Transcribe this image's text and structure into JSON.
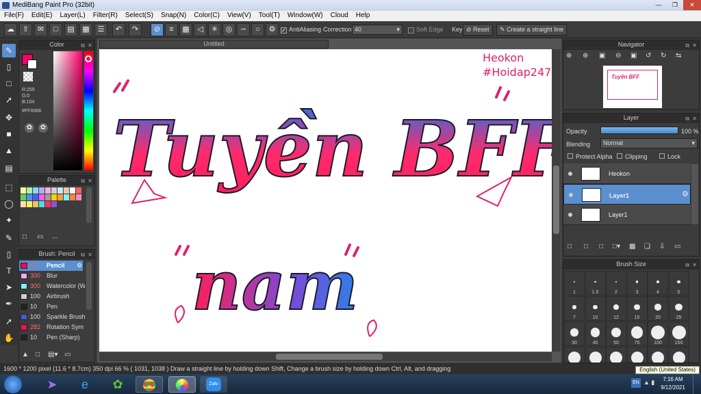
{
  "window": {
    "title": "MediBang Paint Pro (32bit)"
  },
  "menu": [
    "File(F)",
    "Edit(E)",
    "Layer(L)",
    "Filter(R)",
    "Select(S)",
    "Snap(N)",
    "Color(C)",
    "View(V)",
    "Tool(T)",
    "Window(W)",
    "Cloud",
    "Help"
  ],
  "toolbar": {
    "antialias": "AntiAliasing",
    "correction_label": "Correction",
    "correction_value": "40",
    "soft_edge": "Soft Edge",
    "key_label": "Key",
    "reset": "Reset",
    "straight_line": "Create a straight line"
  },
  "color_panel": {
    "title": "Color",
    "r": "R:255",
    "g": "G:0",
    "b": "B:104",
    "hex": "#FF0068",
    "fg": "#ff0068"
  },
  "palette_panel": {
    "title": "Palette",
    "swatches": [
      "#f6f6a0",
      "#a8f0a8",
      "#8bd6f2",
      "#b0b0f0",
      "#f0b0e0",
      "#d0d0d0",
      "#c8e8f8",
      "#e8c8a8",
      "#f8f8f8",
      "#ff6060",
      "#60d060",
      "#5090f0",
      "#4060ff",
      "#f060f0",
      "#a0a0a0",
      "#ffd000",
      "#f0a040",
      "#80f0f0",
      "#ff8040",
      "#f090c0",
      "#ffe0b0",
      "#f0f060",
      "#f0c060",
      "#40e0e0",
      "#ff3060",
      "#9050e0"
    ],
    "dash": "---"
  },
  "brush_panel": {
    "title": "Brush: Pencil",
    "items": [
      {
        "size": "4",
        "name": "Pencil",
        "color": "#ff0068"
      },
      {
        "size": "300",
        "name": "Blur",
        "color": "#f7a8f0"
      },
      {
        "size": "300",
        "name": "Watercolor (W",
        "color": "#8de8f8"
      },
      {
        "size": "100",
        "name": "Airbrush",
        "color": "#cfcfcf"
      },
      {
        "size": "10",
        "name": "Pen",
        "color": "#222222"
      },
      {
        "size": "100",
        "name": "Sparkle Brush",
        "color": "#3c5fd0"
      },
      {
        "size": "282",
        "name": "Rotation Sym",
        "color": "#ff1040"
      },
      {
        "size": "10",
        "name": "Pen (Sharp)",
        "color": "#222222"
      }
    ]
  },
  "document": {
    "tab": "Untitled"
  },
  "canvas_text": {
    "line1": "Heokon",
    "line2": "#Hoidap247",
    "title1": "Tuyền BFF",
    "title2": "nam"
  },
  "navigator": {
    "title": "Navigator"
  },
  "layer_panel": {
    "title": "Layer",
    "opacity_label": "Opacity",
    "opacity_value": "100 %",
    "opacity": 1.0,
    "blending_label": "Blending",
    "blending_value": "Normal",
    "protect_alpha": "Protect Alpha",
    "clipping": "Clipping",
    "lock": "Lock",
    "layers": [
      {
        "name": "Heokon",
        "selected": false
      },
      {
        "name": "Layer1",
        "selected": true
      },
      {
        "name": "Layer1",
        "selected": false
      }
    ]
  },
  "brush_size_panel": {
    "title": "Brush Size",
    "sizes": [
      "1",
      "1.5",
      "2",
      "3",
      "4",
      "5",
      "7",
      "10",
      "12",
      "15",
      "20",
      "25",
      "30",
      "40",
      "50",
      "70",
      "100",
      "150"
    ]
  },
  "status": {
    "text": "1600 * 1200 pixel  (11.6 * 8.7cm)  350 dpi  66 %  ( 1031, 1038 )  Draw a straight line by holding down Shift, Change a brush size by holding down Ctrl, Alt, and dragging"
  },
  "taskbar": {
    "tooltip": "English (United States)",
    "lang": "EN",
    "time": "7:16 AM",
    "date": "9/12/2021",
    "zalo": "Zalo"
  }
}
